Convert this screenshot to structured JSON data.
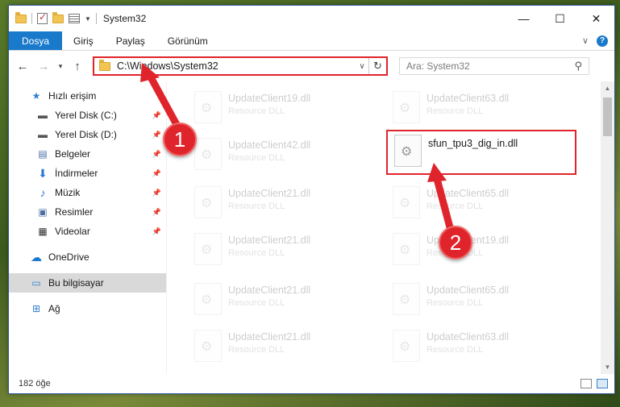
{
  "window": {
    "title": "System32"
  },
  "ribbon": {
    "tabs": [
      "Dosya",
      "Giriş",
      "Paylaş",
      "Görünüm"
    ],
    "help": "?"
  },
  "address": {
    "path": "C:\\Windows\\System32",
    "refresh": "↻"
  },
  "search": {
    "placeholder": "Ara: System32"
  },
  "sidebar": {
    "items": [
      {
        "label": "Hızlı erişim",
        "icon": "star-icon"
      },
      {
        "label": "Yerel Disk (C:)",
        "icon": "drive-icon"
      },
      {
        "label": "Yerel Disk (D:)",
        "icon": "drive-icon"
      },
      {
        "label": "Belgeler",
        "icon": "document-icon"
      },
      {
        "label": "İndirmeler",
        "icon": "download-icon"
      },
      {
        "label": "Müzik",
        "icon": "music-icon"
      },
      {
        "label": "Resimler",
        "icon": "pictures-icon"
      },
      {
        "label": "Videolar",
        "icon": "video-icon"
      },
      {
        "label": "OneDrive",
        "icon": "cloud-icon"
      },
      {
        "label": "Bu bilgisayar",
        "icon": "computer-icon"
      },
      {
        "label": "Ağ",
        "icon": "network-icon"
      }
    ]
  },
  "files": [
    {
      "name": "UpdateClient19.dll",
      "type": "Resource DLL"
    },
    {
      "name": "UpdateClient63.dll",
      "type": "Resource DLL"
    },
    {
      "name": "UpdateClient42.dll",
      "type": "Resource DLL"
    },
    {
      "name": "sfun_tpu3_dig_in.dll",
      "type": ""
    },
    {
      "name": "UpdateClient21.dll",
      "type": "Resource DLL"
    },
    {
      "name": "UpdateClient65.dll",
      "type": "Resource DLL"
    },
    {
      "name": "UpdateClient21.dll",
      "type": "Resource DLL"
    },
    {
      "name": "UpdateClient19.dll",
      "type": "Resource DLL"
    },
    {
      "name": "UpdateClient21.dll",
      "type": "Resource DLL"
    },
    {
      "name": "UpdateClient65.dll",
      "type": "Resource DLL"
    },
    {
      "name": "UpdateClient21.dll",
      "type": "Resource DLL"
    },
    {
      "name": "UpdateClient63.dll",
      "type": "Resource DLL"
    }
  ],
  "status": {
    "count": "182 öğe"
  },
  "annotations": {
    "step1": "1",
    "step2": "2",
    "color": "#e0242b"
  }
}
